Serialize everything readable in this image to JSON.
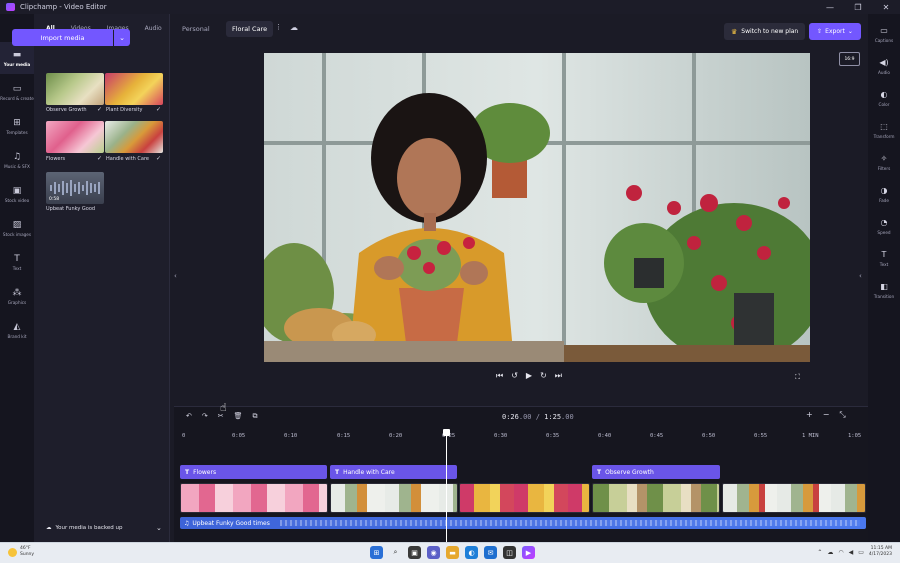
{
  "window": {
    "title": "Clipchamp - Video Editor",
    "controls": [
      "—",
      "❐",
      "✕"
    ]
  },
  "rail": [
    {
      "label": "Your media",
      "icon": "folder-icon",
      "glyph": "▬",
      "active": true
    },
    {
      "label": "Record & create",
      "icon": "camera-icon",
      "glyph": "▭"
    },
    {
      "label": "Templates",
      "icon": "templates-icon",
      "glyph": "⊞"
    },
    {
      "label": "Music & SFX",
      "icon": "music-icon",
      "glyph": "♫"
    },
    {
      "label": "Stock video",
      "icon": "film-icon",
      "glyph": "▣"
    },
    {
      "label": "Stock images",
      "icon": "image-icon",
      "glyph": "▨"
    },
    {
      "label": "Text",
      "icon": "text-icon",
      "glyph": "T"
    },
    {
      "label": "Graphics",
      "icon": "graphics-icon",
      "glyph": "⁂"
    },
    {
      "label": "Brand kit",
      "icon": "brand-kit-icon",
      "glyph": "◭"
    }
  ],
  "media": {
    "tabs": [
      "All",
      "Videos",
      "Images",
      "Audio"
    ],
    "import_label": "Import media",
    "import_dropdown": "⌄",
    "items": [
      {
        "label": "Observe Growth"
      },
      {
        "label": "Plant Diversity"
      },
      {
        "label": "Flowers"
      },
      {
        "label": "Handle with Care"
      },
      {
        "label": "Upbeat Funky Good",
        "duration": "0:58"
      }
    ],
    "check": "✓",
    "backup_text": "Your media is backed up"
  },
  "topbar": {
    "breadcrumb_root": "Personal",
    "project_name": "Floral Care",
    "more": "⋮",
    "switch_plan": "Switch to new plan",
    "export": "Export",
    "aspect": "16:9"
  },
  "right_panel": [
    {
      "label": "Captions",
      "icon": "captions-icon",
      "glyph": "▭"
    },
    {
      "label": "Audio",
      "icon": "audio-icon",
      "glyph": "◀)"
    },
    {
      "label": "Color",
      "icon": "color-icon",
      "glyph": "◐"
    },
    {
      "label": "Transform",
      "icon": "transform-icon",
      "glyph": "⬚"
    },
    {
      "label": "Filters",
      "icon": "filters-icon",
      "glyph": "✧"
    },
    {
      "label": "Fade",
      "icon": "fade-icon",
      "glyph": "◑"
    },
    {
      "label": "Speed",
      "icon": "speed-icon",
      "glyph": "◔"
    },
    {
      "label": "Text",
      "icon": "text-icon",
      "glyph": "T"
    },
    {
      "label": "Transition",
      "icon": "transition-icon",
      "glyph": "◧"
    }
  ],
  "timeline": {
    "current_time": "0:26",
    "current_frac": ".00",
    "total_time": "1:25",
    "total_frac": ".00",
    "ticks": [
      "0",
      "0:05",
      "0:10",
      "0:15",
      "0:20",
      "0:25",
      "0:30",
      "0:35",
      "0:40",
      "0:45",
      "0:50",
      "0:55",
      "1 MIN",
      "1:05"
    ],
    "title_clips": [
      {
        "label": "Flowers"
      },
      {
        "label": "Handle with Care"
      },
      {
        "label": "Observe Growth"
      }
    ],
    "audio_label": "Upbeat Funky Good times"
  },
  "taskbar": {
    "weather_temp": "46°F",
    "weather_desc": "Sunny",
    "time": "11:15 AM",
    "date": "4/17/2023"
  }
}
